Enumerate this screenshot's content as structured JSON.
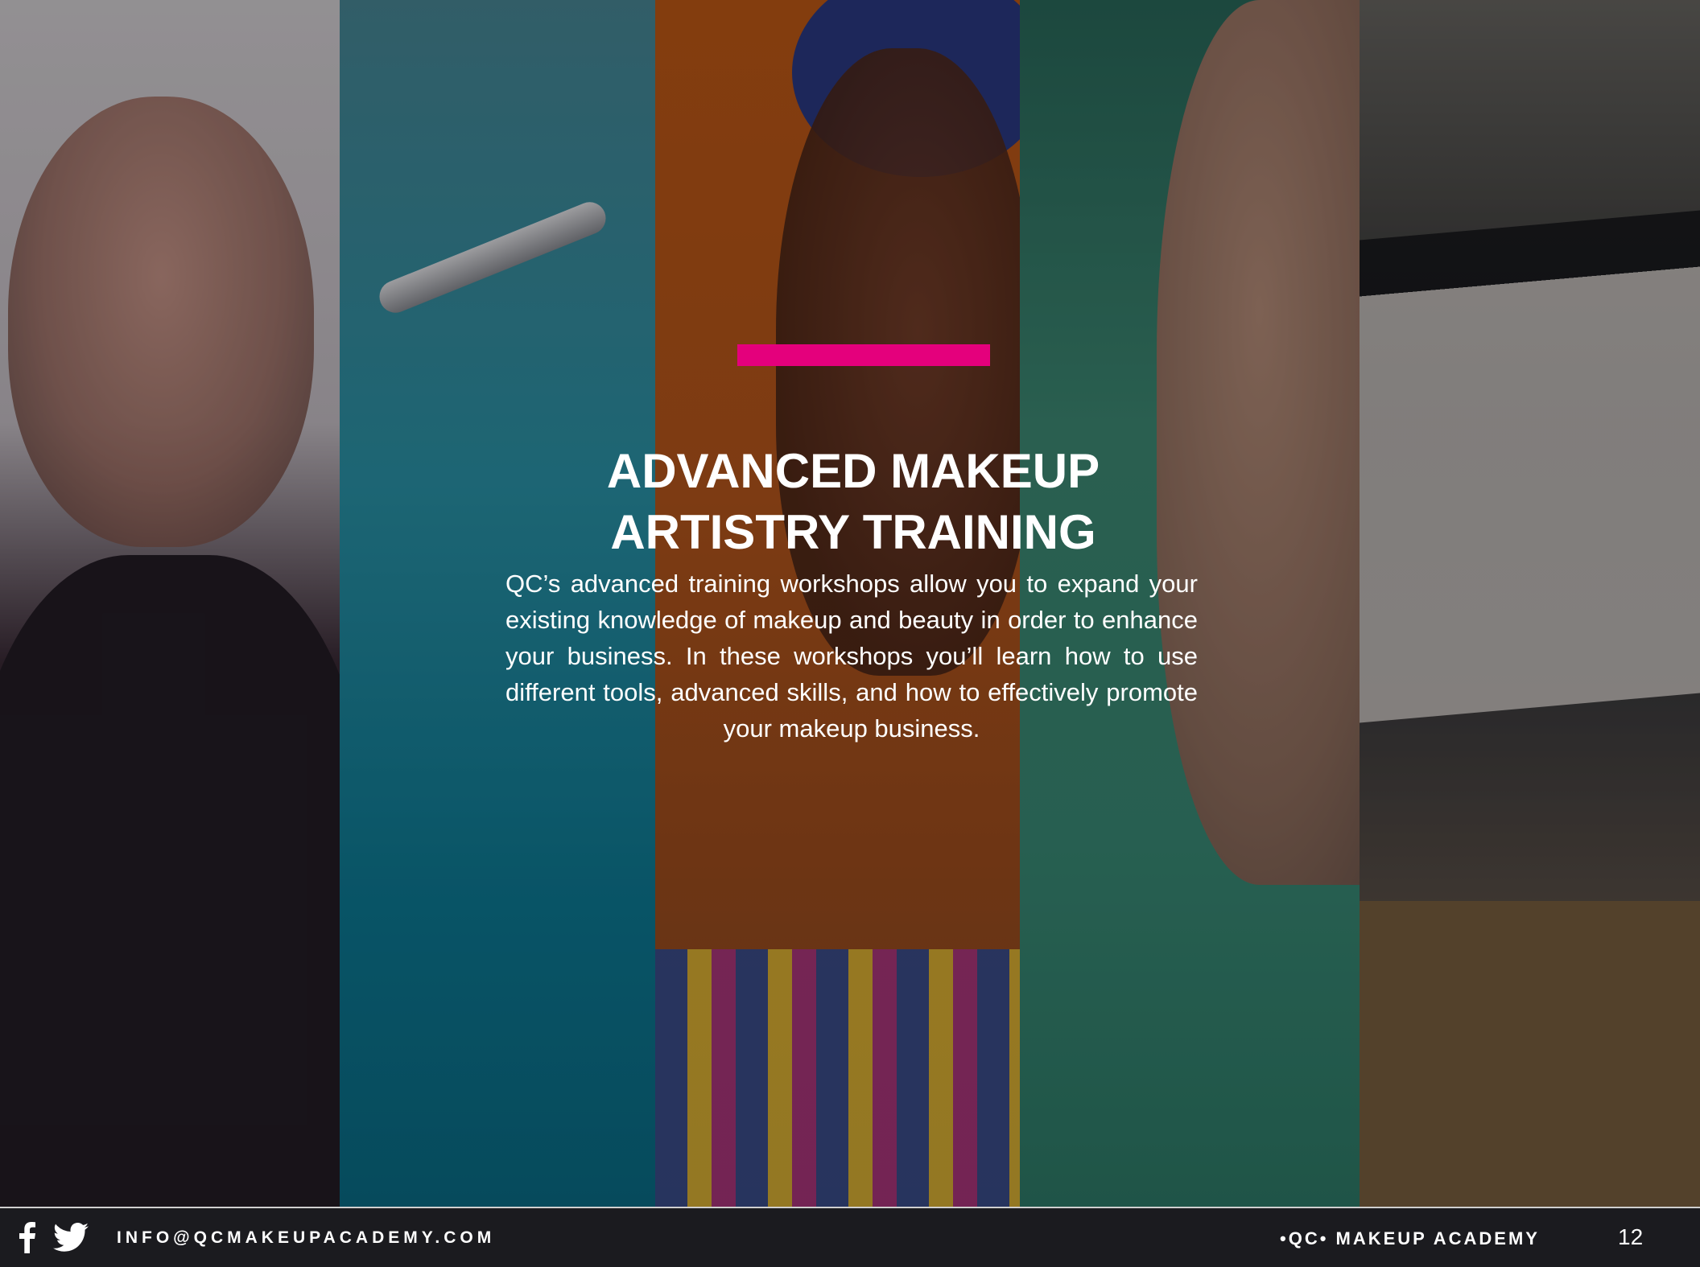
{
  "slide": {
    "heading_line1": "ADVANCED MAKEUP",
    "heading_line2": "ARTISTRY TRAINING",
    "body": "QC’s advanced training workshops allow you to expand your existing knowledge of makeup and beauty in order to enhance your business.  In these workshops you’ll learn how to use different tools, advanced skills, and how to effectively promote your makeup business.",
    "accent_color": "#e4007c"
  },
  "footer": {
    "email": "INFO@QCMAKEUPACADEMY.COM",
    "brand": "•QC• MAKEUP ACADEMY",
    "page_number": "12",
    "icons": [
      "facebook-icon",
      "twitter-icon"
    ]
  }
}
